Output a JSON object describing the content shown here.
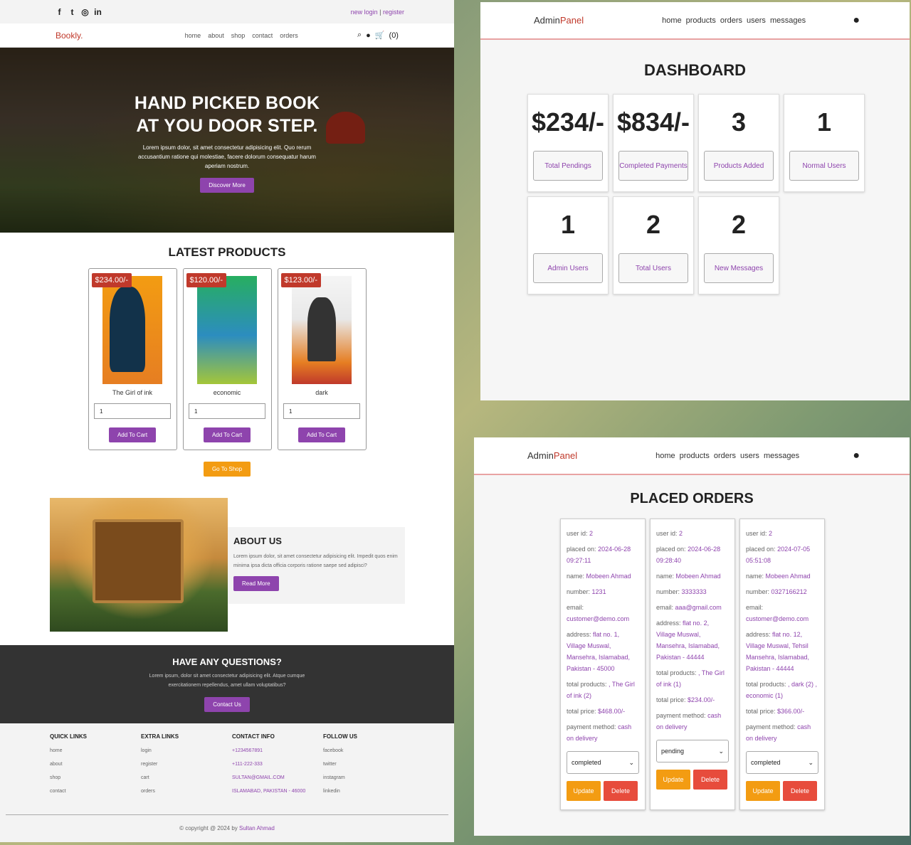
{
  "bookly": {
    "social_icons": [
      "facebook-icon",
      "twitter-icon",
      "instagram-icon",
      "linkedin-icon"
    ],
    "auth": {
      "new_login": "new login",
      "sep": "|",
      "register": "register"
    },
    "logo": "Bookly.",
    "nav": [
      "home",
      "about",
      "shop",
      "contact",
      "orders"
    ],
    "cart_count": "(0)",
    "hero": {
      "title_line1": "HAND PICKED BOOK",
      "title_line2": "AT YOU DOOR STEP.",
      "text": "Lorem ipsum dolor, sit amet consectetur adipisicing elit. Quo rerum accusantium ratione qui molestiae, facere dolorum consequatur harum aperiam nostrum.",
      "button": "Discover More"
    },
    "latest_title": "LATEST PRODUCTS",
    "products": [
      {
        "price": "$234.00/-",
        "title": "The Girl of ink",
        "qty": "1",
        "button": "Add To Cart"
      },
      {
        "price": "$120.00/-",
        "title": "economic",
        "qty": "1",
        "button": "Add To Cart"
      },
      {
        "price": "$123.00/-",
        "title": "dark",
        "qty": "1",
        "button": "Add To Cart"
      }
    ],
    "go_shop": "Go To Shop",
    "about": {
      "title": "ABOUT US",
      "text": "Lorem ipsum dolor, sit amet consectetur adipisicing elit. Impedit quos enim minima ipsa dicta officia corporis ratione saepe sed adipisci?",
      "button": "Read More"
    },
    "questions": {
      "title": "HAVE ANY QUESTIONS?",
      "text": "Lorem ipsum, dolor sit amet consectetur adipisicing elit. Atque cumque exercitationem repellendus, amet ullam voluptatibus?",
      "button": "Contact Us"
    },
    "footer": {
      "quick": {
        "title": "QUICK LINKS",
        "items": [
          "home",
          "about",
          "shop",
          "contact"
        ]
      },
      "extra": {
        "title": "EXTRA LINKS",
        "items": [
          "login",
          "register",
          "cart",
          "orders"
        ]
      },
      "contact": {
        "title": "CONTACT INFO",
        "items": [
          "+1234567891",
          "+111-222-333",
          "SULTAN@GMAIL.COM",
          "ISLAMABAD, PAKISTAN - 46000"
        ]
      },
      "follow": {
        "title": "FOLLOW US",
        "items": [
          "facebook",
          "twitter",
          "instagram",
          "linkedin"
        ]
      },
      "copyright": "© copyright @ 2024 by",
      "author": "Sultan Ahmad"
    }
  },
  "admin": {
    "logo_a": "Admin",
    "logo_b": "Panel",
    "nav": [
      "home",
      "products",
      "orders",
      "users",
      "messages"
    ]
  },
  "dashboard": {
    "title": "DASHBOARD",
    "cards": [
      {
        "value": "$234/-",
        "label": "Total Pendings"
      },
      {
        "value": "$834/-",
        "label": "Completed Payments"
      },
      {
        "value": "3",
        "label": "Products Added"
      },
      {
        "value": "1",
        "label": "Normal Users"
      },
      {
        "value": "1",
        "label": "Admin Users"
      },
      {
        "value": "2",
        "label": "Total Users"
      },
      {
        "value": "2",
        "label": "New Messages"
      }
    ]
  },
  "orders": {
    "title": "PLACED ORDERS",
    "labels": {
      "user_id": "user id:",
      "placed_on": "placed on:",
      "name": "name:",
      "number": "number:",
      "email": "email:",
      "address": "address:",
      "total_products": "total products:",
      "total_price": "total price:",
      "payment": "payment method:"
    },
    "update_btn": "Update",
    "delete_btn": "Delete",
    "items": [
      {
        "user_id": "2",
        "placed_on": "2024-06-28 09:27:11",
        "name": "Mobeen Ahmad",
        "number": "1231",
        "email": "customer@demo.com",
        "address": "flat no. 1, Village Muswal, Mansehra, Islamabad, Pakistan - 45000",
        "total_products": ", The Girl of ink (2)",
        "total_price": "$468.00/-",
        "payment": "cash on delivery",
        "status": "completed"
      },
      {
        "user_id": "2",
        "placed_on": "2024-06-28 09:28:40",
        "name": "Mobeen Ahmad",
        "number": "3333333",
        "email": "aaa@gmail.com",
        "address": "flat no. 2, Village Muswal, Mansehra, Islamabad, Pakistan - 44444",
        "total_products": ", The Girl of ink (1)",
        "total_price": "$234.00/-",
        "payment": "cash on delivery",
        "status": "pending"
      },
      {
        "user_id": "2",
        "placed_on": "2024-07-05 05:51:08",
        "name": "Mobeen Ahmad",
        "number": "0327166212",
        "email": "customer@demo.com",
        "address": "flat no. 12, Village Muswal, Tehsil Mansehra, Islamabad, Pakistan - 44444",
        "total_products": ", dark (2) , economic (1)",
        "total_price": "$366.00/-",
        "payment": "cash on delivery",
        "status": "completed"
      }
    ]
  }
}
